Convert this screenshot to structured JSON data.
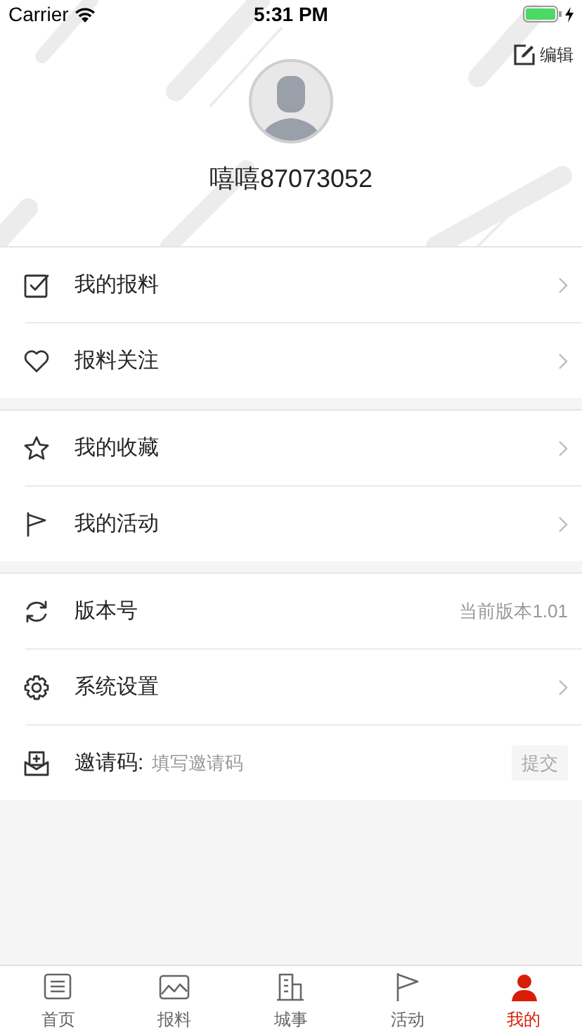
{
  "status_bar": {
    "carrier": "Carrier",
    "time": "5:31 PM"
  },
  "header": {
    "edit": "编辑",
    "username": "嘻嘻87073052"
  },
  "groups": [
    {
      "items": [
        {
          "kind": "link",
          "label": "我的报料"
        },
        {
          "kind": "link",
          "label": "报料关注"
        }
      ]
    },
    {
      "items": [
        {
          "kind": "link",
          "label": "我的收藏"
        },
        {
          "kind": "link",
          "label": "我的活动"
        }
      ]
    },
    {
      "items": [
        {
          "kind": "value",
          "label": "版本号",
          "value": "当前版本1.01"
        },
        {
          "kind": "link",
          "label": "系统设置"
        },
        {
          "kind": "invite",
          "label": "邀请码:",
          "placeholder": "填写邀请码",
          "button": "提交"
        }
      ]
    }
  ],
  "tabs": [
    {
      "label": "首页",
      "selected": false
    },
    {
      "label": "报料",
      "selected": false
    },
    {
      "label": "城事",
      "selected": false
    },
    {
      "label": "活动",
      "selected": false
    },
    {
      "label": "我的",
      "selected": true
    }
  ]
}
